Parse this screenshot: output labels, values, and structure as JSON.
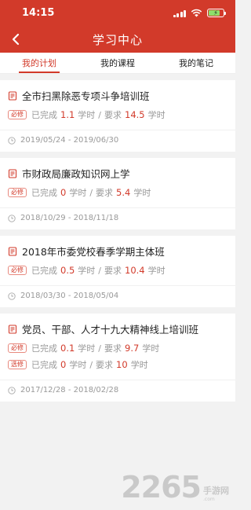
{
  "status_bar": {
    "time": "14:15"
  },
  "header": {
    "title": "学习中心"
  },
  "tabs": [
    {
      "label": "我的计划",
      "active": true
    },
    {
      "label": "我的课程",
      "active": false
    },
    {
      "label": "我的笔记",
      "active": false
    }
  ],
  "plans": [
    {
      "name": "全市扫黑除恶专项斗争培训班",
      "rows": [
        {
          "tag": "必修",
          "done_label": "已完成",
          "done_value": "1.1",
          "unit1": "学时",
          "sep": "/",
          "req_label": "要求",
          "req_value": "14.5",
          "unit2": "学时"
        }
      ],
      "date": "2019/05/24 - 2019/06/30"
    },
    {
      "name": "市财政局廉政知识网上学",
      "rows": [
        {
          "tag": "必修",
          "done_label": "已完成",
          "done_value": "0",
          "unit1": "学时",
          "sep": "/",
          "req_label": "要求",
          "req_value": "5.4",
          "unit2": "学时"
        }
      ],
      "date": "2018/10/29 - 2018/11/18"
    },
    {
      "name": "2018年市委党校春季学期主体班",
      "rows": [
        {
          "tag": "必修",
          "done_label": "已完成",
          "done_value": "0.5",
          "unit1": "学时",
          "sep": "/",
          "req_label": "要求",
          "req_value": "10.4",
          "unit2": "学时"
        }
      ],
      "date": "2018/03/30 - 2018/05/04"
    },
    {
      "name": "党员、干部、人才十九大精神线上培训班",
      "rows": [
        {
          "tag": "必修",
          "done_label": "已完成",
          "done_value": "0.1",
          "unit1": "学时",
          "sep": "/",
          "req_label": "要求",
          "req_value": "9.7",
          "unit2": "学时"
        },
        {
          "tag": "选修",
          "done_label": "已完成",
          "done_value": "0",
          "unit1": "学时",
          "sep": "/",
          "req_label": "要求",
          "req_value": "10",
          "unit2": "学时"
        }
      ],
      "date": "2017/12/28 - 2018/02/28"
    }
  ],
  "watermark": {
    "number": "2265",
    "cn": "手游网",
    "en": ".com"
  },
  "colors": {
    "accent": "#d23a2a",
    "background": "#f2f2f2"
  }
}
